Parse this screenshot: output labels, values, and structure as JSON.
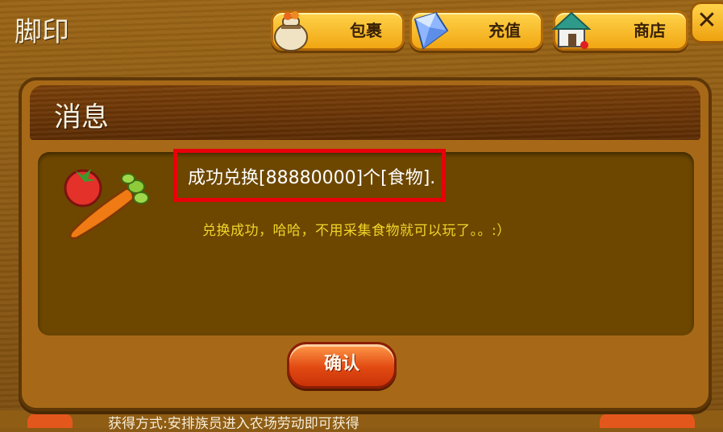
{
  "window": {
    "title": "脚印"
  },
  "toolbar": {
    "bag_label": "包裹",
    "recharge_label": "充值",
    "shop_label": "商店",
    "close_symbol": "✕"
  },
  "dialog": {
    "title": "消息",
    "message_main": "成功兑换[88880000]个[食物].",
    "message_sub": "兑换成功，哈哈，不用采集食物就可以玩了。。:）",
    "confirm_label": "确认",
    "icon": "food-icon"
  },
  "background": {
    "hint_text": "获得方式:安排族员进入农场劳动即可获得"
  },
  "colors": {
    "highlight_border": "#e8000a",
    "sub_message": "#f1d52a",
    "confirm_button": "#e24a12"
  }
}
